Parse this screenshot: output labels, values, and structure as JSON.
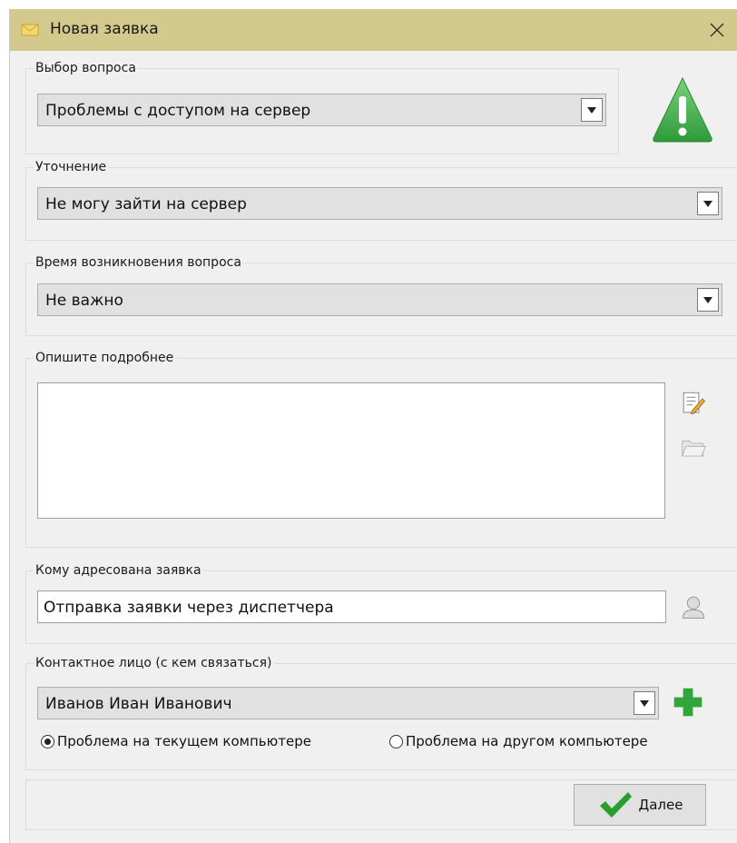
{
  "window": {
    "title": "Новая заявка",
    "title_icon": "envelope-icon",
    "close_icon": "close-icon"
  },
  "question": {
    "label": "Выбор вопроса",
    "value": "Проблемы с доступом на сервер",
    "warning_icon": "warning-icon"
  },
  "clarification": {
    "label": "Уточнение",
    "value": "Не могу зайти на сервер"
  },
  "time": {
    "label": "Время возникновения вопроса",
    "value": "Не важно"
  },
  "details": {
    "label": "Опишите подробнее",
    "value": "",
    "edit_icon": "edit-note-icon",
    "attach_icon": "folder-icon"
  },
  "addressee": {
    "label": "Кому адресована заявка",
    "value": "Отправка заявки через диспетчера",
    "user_icon": "user-icon"
  },
  "contact": {
    "label": "Контактное лицо (с кем связаться)",
    "value": "Иванов Иван Иванович",
    "add_icon": "plus-icon",
    "radio_current": "Проблема на текущем компьютере",
    "radio_other": "Проблема на другом компьютере",
    "selected": "current"
  },
  "footer": {
    "next_label": "Далее",
    "next_icon": "checkmark-icon"
  },
  "colors": {
    "titlebar": "#d4c98c",
    "warning_green": "#3fa848",
    "add_green": "#2fa53a",
    "check_green": "#2a9d2f"
  }
}
